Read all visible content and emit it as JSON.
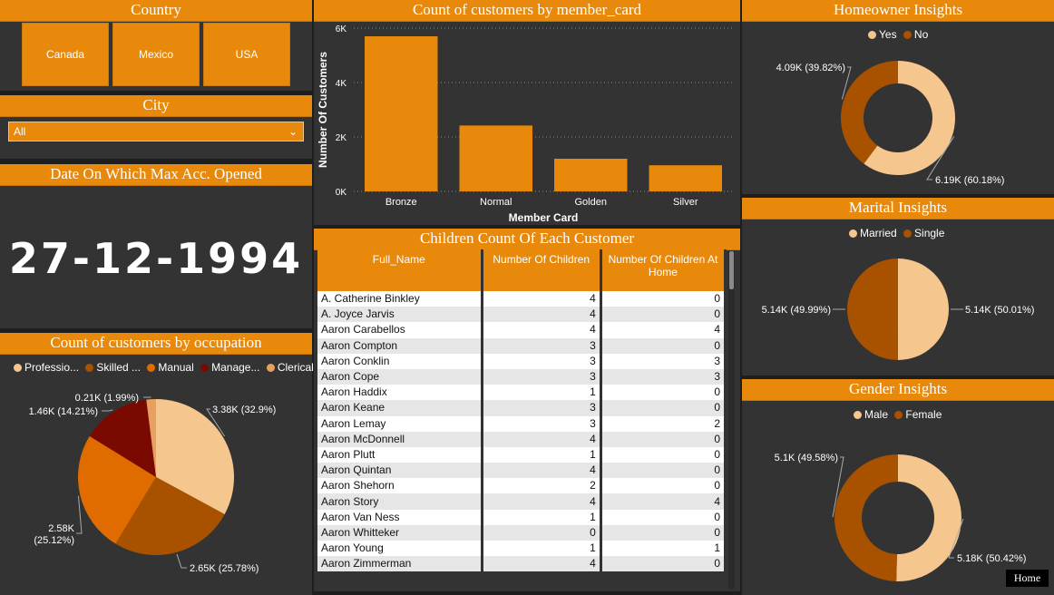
{
  "country": {
    "title": "Country",
    "buttons": [
      "Canada",
      "Mexico",
      "USA"
    ]
  },
  "city": {
    "title": "City",
    "selected": "All"
  },
  "date_panel": {
    "title": "Date On Which Max Acc. Opened",
    "value": "27-12-1994"
  },
  "occupation": {
    "title": "Count of customers by occupation",
    "legend": [
      "Professio...",
      "Skilled ...",
      "Manual",
      "Manage...",
      "Clerical"
    ]
  },
  "member_card": {
    "title": "Count of customers by member_card"
  },
  "children": {
    "title": "Children Count Of Each Customer",
    "columns": [
      "Full_Name",
      "Number Of Children",
      "Number Of Children At Home"
    ],
    "rows": [
      [
        "A. Catherine Binkley",
        "4",
        "0"
      ],
      [
        "A. Joyce Jarvis",
        "4",
        "0"
      ],
      [
        "Aaron Carabellos",
        "4",
        "4"
      ],
      [
        "Aaron Compton",
        "3",
        "0"
      ],
      [
        "Aaron Conklin",
        "3",
        "3"
      ],
      [
        "Aaron Cope",
        "3",
        "3"
      ],
      [
        "Aaron Haddix",
        "1",
        "0"
      ],
      [
        "Aaron Keane",
        "3",
        "0"
      ],
      [
        "Aaron Lemay",
        "3",
        "2"
      ],
      [
        "Aaron McDonnell",
        "4",
        "0"
      ],
      [
        "Aaron Plutt",
        "1",
        "0"
      ],
      [
        "Aaron Quintan",
        "4",
        "0"
      ],
      [
        "Aaron Shehorn",
        "2",
        "0"
      ],
      [
        "Aaron Story",
        "4",
        "4"
      ],
      [
        "Aaron Van Ness",
        "1",
        "0"
      ],
      [
        "Aaron Whitteker",
        "0",
        "0"
      ],
      [
        "Aaron Young",
        "1",
        "1"
      ],
      [
        "Aaron Zimmerman",
        "4",
        "0"
      ]
    ]
  },
  "homeowner": {
    "title": "Homeowner Insights",
    "legend": [
      "Yes",
      "No"
    ]
  },
  "marital": {
    "title": "Marital Insights",
    "legend": [
      "Married",
      "Single"
    ]
  },
  "gender": {
    "title": "Gender Insights",
    "legend": [
      "Male",
      "Female"
    ]
  },
  "nav": {
    "home_label": "Home"
  },
  "colors": {
    "accent": "#e8890c",
    "light": "#f5c68e",
    "dark": "#a85200",
    "orange": "#e06c00",
    "maroon": "#7a0a00",
    "clerical": "#e8a060"
  },
  "chart_data": [
    {
      "type": "bar",
      "title": "Count of customers by member_card",
      "categories": [
        "Bronze",
        "Normal",
        "Golden",
        "Silver"
      ],
      "values": [
        5700,
        2420,
        1200,
        960
      ],
      "xlabel": "Member Card",
      "ylabel": "Number Of Customers",
      "yticks": [
        "0K",
        "2K",
        "4K",
        "6K"
      ],
      "ylim": [
        0,
        6000
      ],
      "grid": true
    },
    {
      "type": "pie",
      "title": "Count of customers by occupation",
      "categories": [
        "Professio...",
        "Skilled ...",
        "Manual",
        "Manage...",
        "Clerical"
      ],
      "values": [
        32.9,
        25.78,
        25.12,
        14.21,
        1.99
      ],
      "labels": [
        "3.38K (32.9%)",
        "2.65K (25.78%)",
        "2.58K (25.12%)",
        "1.46K (14.21%)",
        "0.21K (1.99%)"
      ],
      "legend_position": "top-left"
    },
    {
      "type": "pie",
      "title": "Homeowner Insights",
      "categories": [
        "Yes",
        "No"
      ],
      "values": [
        60.18,
        39.82
      ],
      "labels": [
        "6.19K (60.18%)",
        "4.09K (39.82%)"
      ],
      "donut": true
    },
    {
      "type": "pie",
      "title": "Marital Insights",
      "categories": [
        "Married",
        "Single"
      ],
      "values": [
        50.01,
        49.99
      ],
      "labels": [
        "5.14K (50.01%)",
        "5.14K (49.99%)"
      ],
      "donut": false
    },
    {
      "type": "pie",
      "title": "Gender Insights",
      "categories": [
        "Male",
        "Female"
      ],
      "values": [
        50.42,
        49.58
      ],
      "labels": [
        "5.18K (50.42%)",
        "5.1K (49.58%)"
      ],
      "donut": true
    }
  ]
}
